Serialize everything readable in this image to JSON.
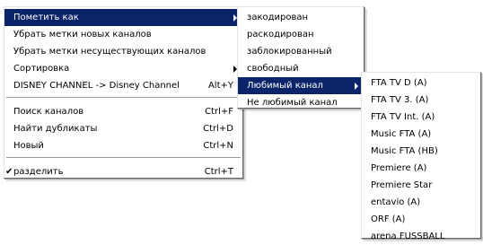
{
  "main_menu": {
    "items": [
      {
        "label": "Пометить как",
        "shortcut": "",
        "submenu": true,
        "selected": true
      },
      {
        "label": "Убрать метки новых каналов",
        "shortcut": ""
      },
      {
        "label": "Убрать метки несуществующих каналов",
        "shortcut": ""
      },
      {
        "label": "Сортировка",
        "shortcut": "",
        "submenu": true
      },
      {
        "label": "DISNEY CHANNEL -> Disney Channel",
        "shortcut": "Alt+Y"
      },
      {
        "label": "Поиск каналов",
        "shortcut": "Ctrl+F"
      },
      {
        "label": "Найти дубликаты",
        "shortcut": "Ctrl+D"
      },
      {
        "label": "Новый",
        "shortcut": "Ctrl+N"
      },
      {
        "label": "разделить",
        "shortcut": "Ctrl+T",
        "checked": true
      }
    ],
    "check_glyph": "✔"
  },
  "mark_submenu": {
    "items": [
      {
        "label": "закодирован"
      },
      {
        "label": "раскодирован"
      },
      {
        "label": "заблокированный"
      },
      {
        "label": "свободный"
      },
      {
        "label": "Любимый канал",
        "submenu": true,
        "selected": true
      },
      {
        "label": "Не любимый канал"
      }
    ]
  },
  "favorites_submenu": {
    "items": [
      {
        "label": "FTA TV D (A)"
      },
      {
        "label": "FTA TV 3. (A)"
      },
      {
        "label": "FTA TV Int. (A)"
      },
      {
        "label": "Music FTA (A)"
      },
      {
        "label": "Music FTA (HB)"
      },
      {
        "label": "Premiere (A)"
      },
      {
        "label": "Premiere Star"
      },
      {
        "label": "entavio (A)"
      },
      {
        "label": "ORF (A)"
      },
      {
        "label": "arena FUSSBALL"
      }
    ]
  },
  "colors": {
    "selection_bg": "#0a246a",
    "selection_fg": "#ffffff",
    "menu_bg": "#ffffff"
  }
}
